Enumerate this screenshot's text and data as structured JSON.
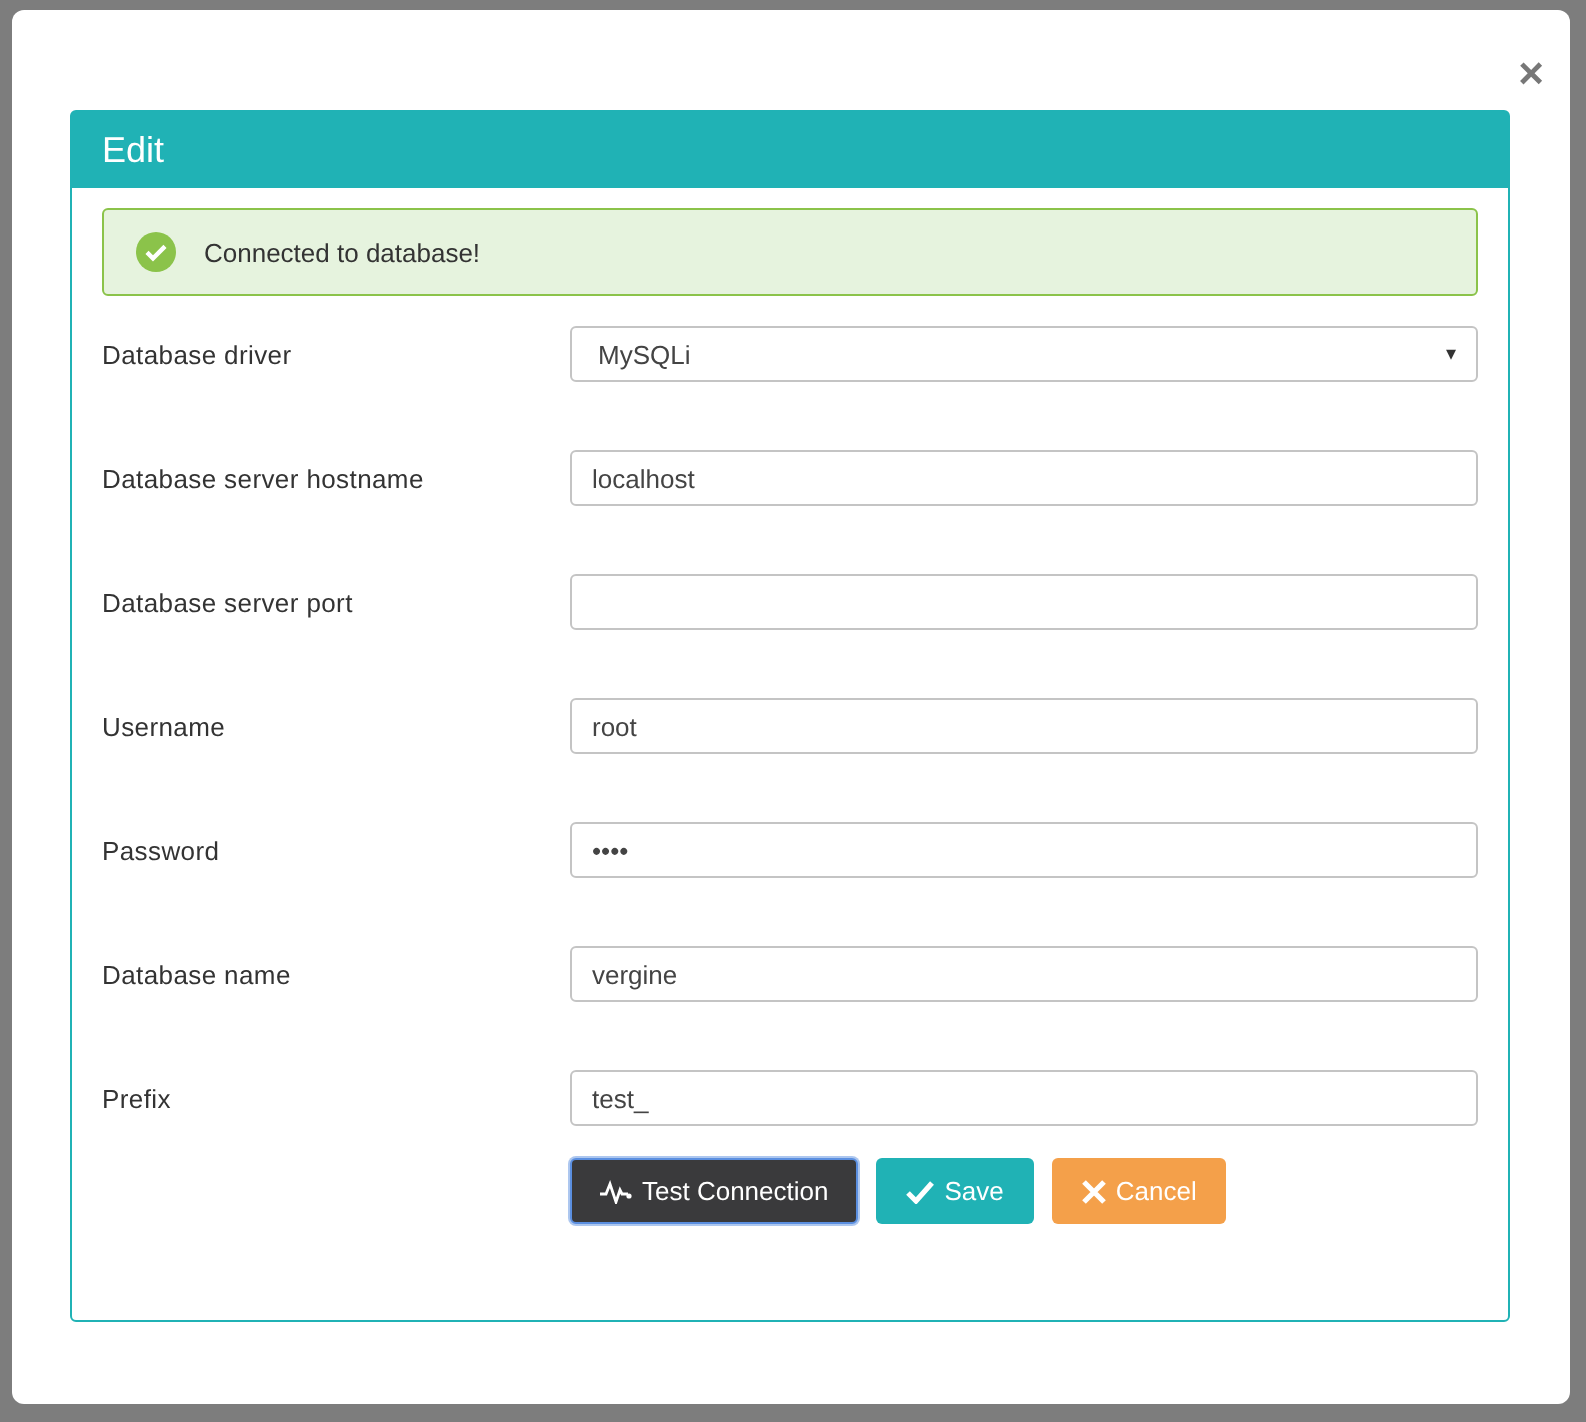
{
  "dialog": {
    "title": "Edit",
    "close_icon": "×"
  },
  "alert": {
    "kind": "success",
    "message": "Connected to database!"
  },
  "fields": [
    {
      "label": "Database driver",
      "kind": "select",
      "value": "MySQLi",
      "caret": "▾"
    },
    {
      "label": "Database server hostname",
      "kind": "text",
      "value": "localhost"
    },
    {
      "label": "Database server port",
      "kind": "text"
    },
    {
      "label": "Username",
      "kind": "text",
      "value": "root"
    },
    {
      "label": "Password",
      "kind": "text",
      "value": "••••"
    },
    {
      "label": "Database name",
      "kind": "text",
      "value": "vergine"
    },
    {
      "label": "Prefix",
      "kind": "text",
      "value": "test_"
    }
  ],
  "buttons": [
    {
      "label": "Test Connection",
      "kind": "test",
      "focused": true
    },
    {
      "label": "Save",
      "kind": "save",
      "focused": false
    },
    {
      "label": "Cancel",
      "kind": "cancel",
      "focused": false
    }
  ]
}
